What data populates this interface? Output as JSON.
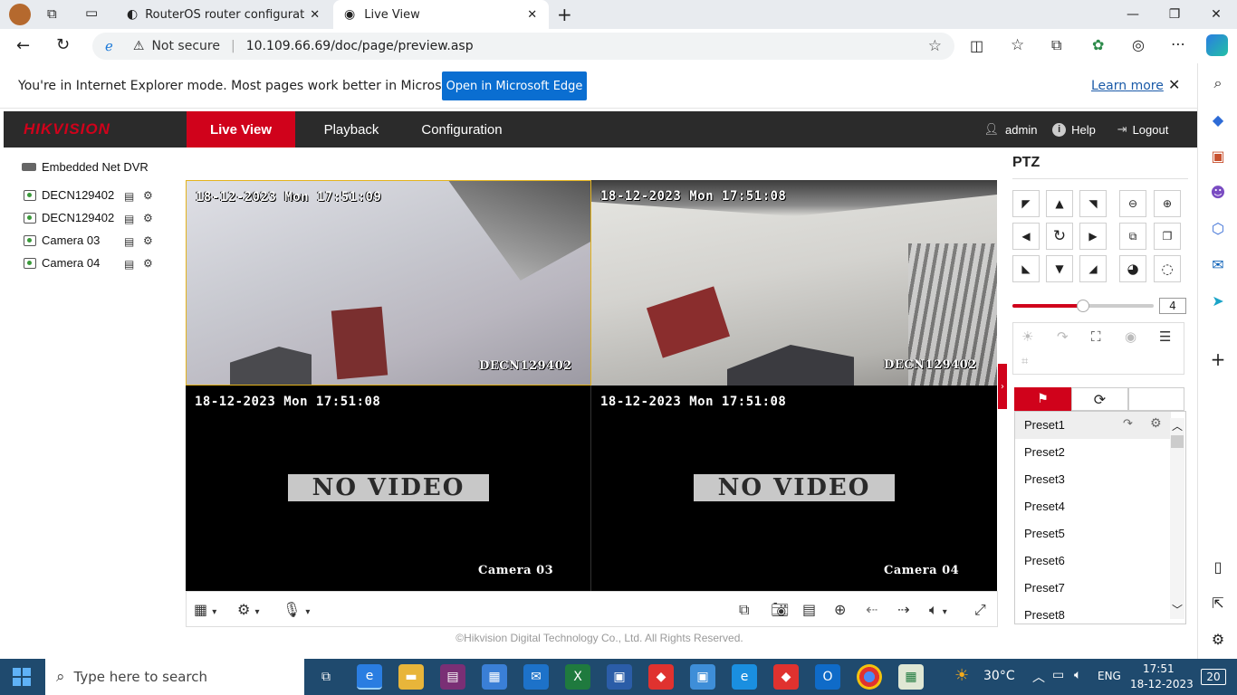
{
  "browser": {
    "tabs": [
      {
        "title": "RouterOS router configuration p"
      },
      {
        "title": "Live View"
      }
    ],
    "address": {
      "security": "Not secure",
      "url": "10.109.66.69/doc/page/preview.asp"
    },
    "ie_banner": {
      "message": "You're in Internet Explorer mode. Most pages work better in Microsoft Edge.",
      "open_button": "Open in Microsoft Edge",
      "learn_more": "Learn more"
    }
  },
  "header": {
    "logo": "HIKVISION",
    "nav": [
      "Live View",
      "Playback",
      "Configuration"
    ],
    "user": "admin",
    "help": "Help",
    "logout": "Logout"
  },
  "device_tree": {
    "root": "Embedded Net DVR",
    "channels": [
      "DECN129402",
      "DECN129402",
      "Camera 03",
      "Camera 04"
    ]
  },
  "video": {
    "cells": [
      {
        "timestamp": "18-12-2023 Mon 17:51:09",
        "name": "DECN129402",
        "status": ""
      },
      {
        "timestamp": "18-12-2023 Mon 17:51:08",
        "name": "DECN129402",
        "status": ""
      },
      {
        "timestamp": "18-12-2023 Mon 17:51:08",
        "name": "Camera 03",
        "status": "NO VIDEO"
      },
      {
        "timestamp": "18-12-2023 Mon 17:51:08",
        "name": "Camera 04",
        "status": "NO VIDEO"
      }
    ],
    "footer": "©Hikvision Digital Technology Co., Ltd. All Rights Reserved."
  },
  "ptz": {
    "title": "PTZ",
    "speed": "4",
    "speed_fraction": 0.5,
    "presets": [
      "Preset1",
      "Preset2",
      "Preset3",
      "Preset4",
      "Preset5",
      "Preset6",
      "Preset7",
      "Preset8"
    ]
  },
  "taskbar": {
    "search_placeholder": "Type here to search",
    "weather": "30°C",
    "language": "ENG",
    "time": "17:51",
    "date": "18-12-2023",
    "notifications": "20"
  },
  "colors": {
    "hik_red": "#d0021b",
    "header_dark": "#2b2b2b",
    "edge_blue": "#0a6ed1"
  }
}
